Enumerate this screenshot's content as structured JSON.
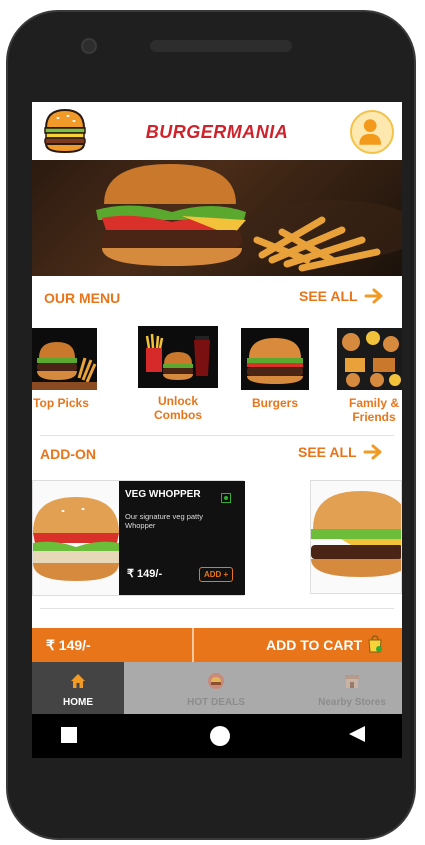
{
  "header": {
    "title": "BURGERMANIA"
  },
  "menu": {
    "title": "OUR MENU",
    "see_all": "SEE ALL",
    "items": [
      {
        "label": "Top Picks"
      },
      {
        "label": "Unlock Combos"
      },
      {
        "label": "Burgers"
      },
      {
        "label": "Family & Friends"
      }
    ]
  },
  "addon": {
    "title": "ADD-ON",
    "see_all": "SEE ALL",
    "card": {
      "name": "VEG WHOPPER",
      "desc": "Our signature veg patty Whopper",
      "price": "₹ 149/-",
      "add": "ADD +"
    }
  },
  "cart": {
    "price": "₹ 149/-",
    "button": "ADD TO CART"
  },
  "nav": {
    "home": "HOME",
    "hot": "HOT DEALS",
    "stores": "Nearby Stores"
  },
  "colors": {
    "accent": "#e8751a",
    "title": "#d0222a"
  }
}
